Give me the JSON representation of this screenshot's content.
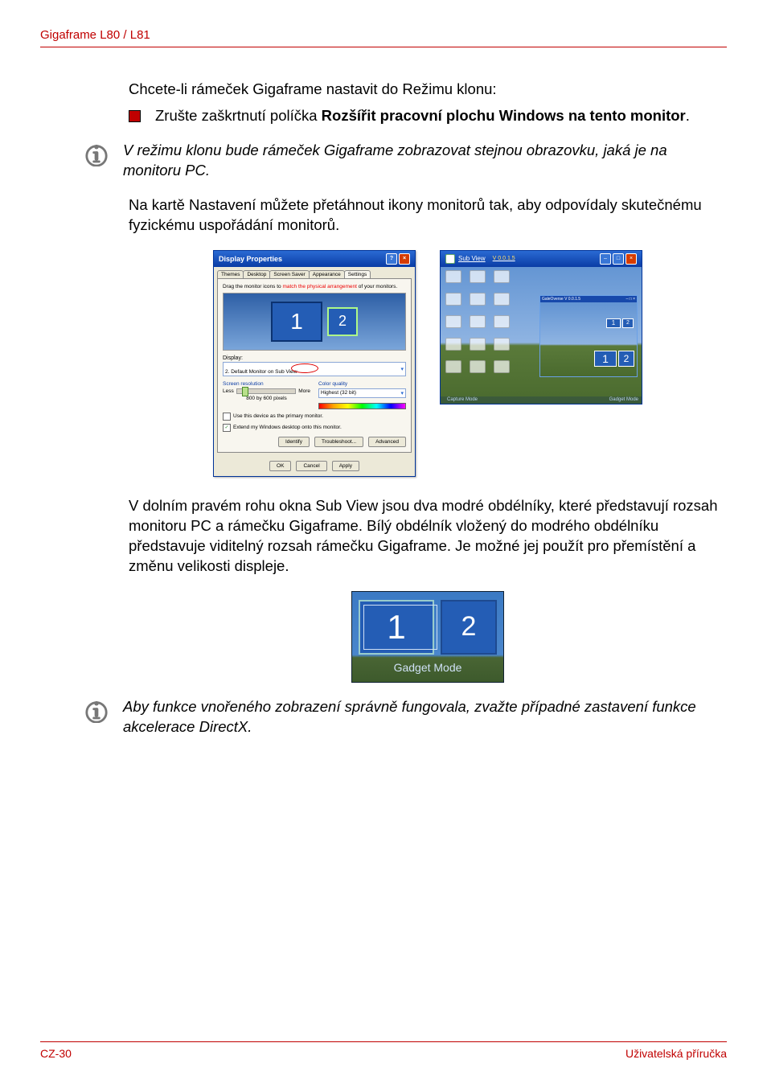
{
  "header": {
    "title": "Gigaframe L80 / L81"
  },
  "text": {
    "intro": "Chcete-li rámeček Gigaframe nastavit do Režimu klonu:",
    "bullet_prefix": "Zrušte zaškrtnutí políčka ",
    "bullet_bold": "Rozšířit pracovní plochu Windows na tento monitor",
    "bullet_suffix": ".",
    "note1": "V režimu klonu bude rámeček Gigaframe zobrazovat stejnou obrazovku, jaká je na monitoru PC.",
    "mid": "Na kartě Nastavení můžete přetáhnout ikony monitorů tak, aby odpovídaly skutečnému fyzickému uspořádání monitorů.",
    "after_figs": "V dolním pravém rohu okna Sub View jsou dva modré obdélníky, které představují rozsah monitoru PC a rámečku Gigaframe. Bílý obdélník vložený do modrého obdélníku představuje viditelný rozsah rámečku Gigaframe. Je možné jej použít pro přemístění a změnu velikosti displeje.",
    "note2": "Aby funkce vnořeného zobrazení správně fungovala, zvažte případné zastavení funkce akcelerace DirectX."
  },
  "dp": {
    "title": "Display Properties",
    "tabs": {
      "themes": "Themes",
      "desktop": "Desktop",
      "screensaver": "Screen Saver",
      "appearance": "Appearance",
      "settings": "Settings"
    },
    "instruction_pre": "Drag the monitor icons to ",
    "instruction_red": "match the physical arrangement",
    "instruction_post": " of your monitors.",
    "mon1": "1",
    "mon2": "2",
    "display_label": "Display:",
    "display_combo": "2. Default Monitor on Sub View",
    "screen_res": "Screen resolution",
    "less": "Less",
    "more": "More",
    "resolution": "800 by 600 pixels",
    "color_quality": "Color quality",
    "color_combo": "Highest (32 bit)",
    "chk_primary": "Use this device as the primary monitor.",
    "chk_extend": "Extend my Windows desktop onto this monitor.",
    "btn_identify": "Identify",
    "btn_troubleshoot": "Troubleshoot...",
    "btn_advanced": "Advanced",
    "btn_ok": "OK",
    "btn_cancel": "Cancel",
    "btn_apply": "Apply"
  },
  "sv": {
    "title": "Sub View",
    "version": "V 0.0.1.5",
    "inset_title": "GaleOverse V 0.0.1.5",
    "r1": "1",
    "r2": "2",
    "foot_left": "Capture Mode",
    "foot_right": "Gadget Mode"
  },
  "gm": {
    "r1": "1",
    "r2": "2",
    "caption": "Gadget Mode"
  },
  "footer": {
    "left": "CZ-30",
    "right": "Uživatelská příručka"
  }
}
